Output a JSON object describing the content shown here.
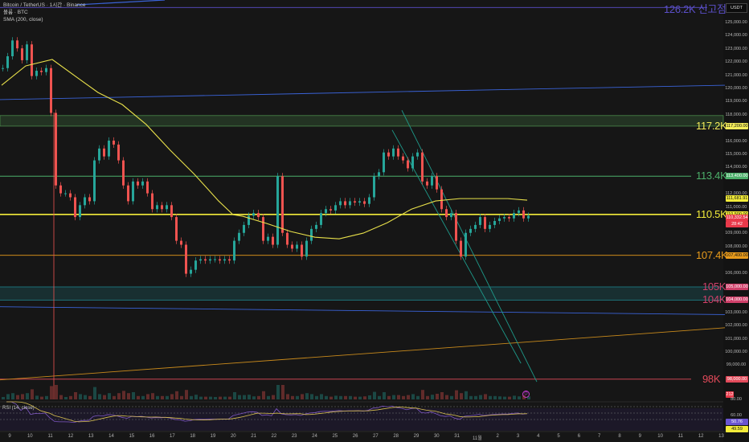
{
  "legend": {
    "symbol": "Bitcoin / TetherUS · 1시간 · Binance",
    "volume": "볼륨 · BTC",
    "sma": "SMA (200, close)"
  },
  "currency_button": "USDT",
  "rsi_title": "RSI (14, close)",
  "alert_icon": "clock-alert",
  "colors": {
    "up": "#26a69a",
    "down": "#ef5350",
    "sma": "#e8e04a",
    "bg": "#161616"
  },
  "levels": [
    {
      "label": "126.2K 신고점",
      "price": 126200,
      "color": "#5b4fc9",
      "kind": "line"
    },
    {
      "label": "117.2K",
      "price": 117200,
      "price_top": 118000,
      "color": "#f3ec5a",
      "zone_color": "#4a8a4a",
      "kind": "zone",
      "tag": "117,200.00"
    },
    {
      "label": "113.4K",
      "price": 113400,
      "color": "#4caf6a",
      "kind": "line",
      "tag": "113,400.00"
    },
    {
      "label": "110.5K",
      "price": 110500,
      "color": "#f3ec3a",
      "kind": "line",
      "tag": "110,500.00"
    },
    {
      "label": "107.4K",
      "price": 107400,
      "color": "#e89b1c",
      "kind": "line",
      "tag": "107,400.00"
    },
    {
      "label": "105K",
      "price": 105000,
      "color": "#d0406a",
      "kind": "zone_top",
      "zone_color": "#1e8a92",
      "tag": "105,000.00"
    },
    {
      "label": "104K",
      "price": 104000,
      "color": "#d0406a",
      "kind": "zone_bottom",
      "tag": "104,000.00"
    },
    {
      "label": "98K",
      "price": 98000,
      "color": "#e24a5a",
      "kind": "line",
      "tag": "98,000.00"
    }
  ],
  "price_tags": {
    "sma_value": "111,681.91",
    "last_price": "110,332.54",
    "countdown": "28:42",
    "volume_value": "212",
    "rsi_value": "50.76",
    "rsi_ma_value": "49.59"
  },
  "chart_data": {
    "type": "candlestick",
    "title": "Bitcoin / TetherUS 1h",
    "y_axis": {
      "ylim": [
        97000,
        126800
      ],
      "ticks": [
        125000,
        124000,
        123000,
        122000,
        121000,
        120000,
        119000,
        118000,
        117000,
        116000,
        115000,
        114000,
        113000,
        112000,
        111000,
        110000,
        109000,
        108000,
        107000,
        106000,
        105000,
        104000,
        103000,
        102000,
        101000,
        100000,
        99000
      ],
      "tick_labels": [
        "125,000.00",
        "124,000.00",
        "123,000.00",
        "122,000.00",
        "121,000.00",
        "120,000.00",
        "119,000.00",
        "118,000.00",
        "117,000.00",
        "116,000.00",
        "115,000.00",
        "114,000.00",
        "113,000.00",
        "112,000.00",
        "111,000.00",
        "110,000.00",
        "109,000.00",
        "108,000.00",
        "107,000.00",
        "106,000.00",
        "105,000.00",
        "104,000.00",
        "103,000.00",
        "102,000.00",
        "101,000.00",
        "100,000.00",
        "99,000.00"
      ]
    },
    "x_axis": {
      "labels": [
        "9",
        "10",
        "11",
        "12",
        "13",
        "14",
        "15",
        "16",
        "17",
        "18",
        "19",
        "20",
        "21",
        "22",
        "23",
        "24",
        "25",
        "26",
        "27",
        "28",
        "29",
        "30",
        "31",
        "11월",
        "2",
        "3",
        "4",
        "5",
        "6",
        "7",
        "8",
        "9",
        "10",
        "11",
        "12",
        "13"
      ]
    },
    "bar_step_days": 0.237,
    "closes": [
      121600,
      122500,
      123700,
      123100,
      122200,
      123400,
      121000,
      121400,
      121300,
      121600,
      118200,
      112700,
      112100,
      112100,
      111800,
      110300,
      111200,
      111800,
      111500,
      114600,
      115500,
      114900,
      116100,
      115800,
      114600,
      112700,
      111500,
      113000,
      112700,
      113000,
      112100,
      110900,
      111200,
      110900,
      111200,
      110300,
      108500,
      108200,
      106000,
      106300,
      107000,
      107100,
      107000,
      107100,
      107100,
      107000,
      107100,
      107000,
      108500,
      109100,
      109700,
      110400,
      110600,
      110300,
      108500,
      108800,
      108200,
      113400,
      109100,
      108200,
      107900,
      108200,
      107300,
      108500,
      109400,
      109700,
      110600,
      110900,
      110800,
      111200,
      111500,
      111200,
      111500,
      111400,
      111500,
      111300,
      111800,
      113400,
      113700,
      115200,
      114900,
      115500,
      114900,
      114600,
      114000,
      114900,
      115200,
      113000,
      112700,
      113400,
      112400,
      110900,
      110300,
      110600,
      108500,
      107300,
      109100,
      109400,
      109700,
      110300,
      109400,
      109700,
      110000,
      110200,
      110300,
      110200,
      110600,
      110800,
      110200,
      110400
    ],
    "sma200": [
      [
        0,
        120300
      ],
      [
        5,
        121770
      ],
      [
        10.5,
        122255
      ],
      [
        16.5,
        120670
      ],
      [
        20,
        119750
      ],
      [
        25,
        118840
      ],
      [
        30,
        117320
      ],
      [
        35,
        115360
      ],
      [
        40,
        113540
      ],
      [
        45,
        111520
      ],
      [
        48,
        110480
      ],
      [
        50,
        110360
      ],
      [
        55,
        109810
      ],
      [
        60,
        109200
      ],
      [
        65,
        108770
      ],
      [
        70,
        108650
      ],
      [
        75,
        109080
      ],
      [
        80,
        109870
      ],
      [
        85,
        110900
      ],
      [
        90,
        111520
      ],
      [
        95,
        111700
      ],
      [
        100,
        111700
      ],
      [
        105,
        111700
      ],
      [
        109,
        111580
      ]
    ],
    "trendlines": [
      {
        "name": "blue-upper",
        "color": "#3a63d8",
        "from": [
          -2,
          119200
        ],
        "to": [
          150,
          120300
        ]
      },
      {
        "name": "blue-lower",
        "color": "#3a63d8",
        "from": [
          -2,
          103500
        ],
        "to": [
          150,
          102900
        ]
      },
      {
        "name": "orange",
        "color": "#c98a1c",
        "from": [
          -2,
          97900
        ],
        "to": [
          150,
          101900
        ]
      },
      {
        "name": "teal-channel-1",
        "color": "#1e9a8a",
        "from": [
          83,
          118400
        ],
        "to": [
          111,
          97800
        ]
      },
      {
        "name": "teal-channel-2",
        "color": "#1e9a8a",
        "from": [
          81,
          116900
        ],
        "to": [
          107.7,
          99200
        ]
      }
    ],
    "rsi": {
      "period": 14,
      "levels": [
        70,
        50,
        30
      ]
    }
  }
}
